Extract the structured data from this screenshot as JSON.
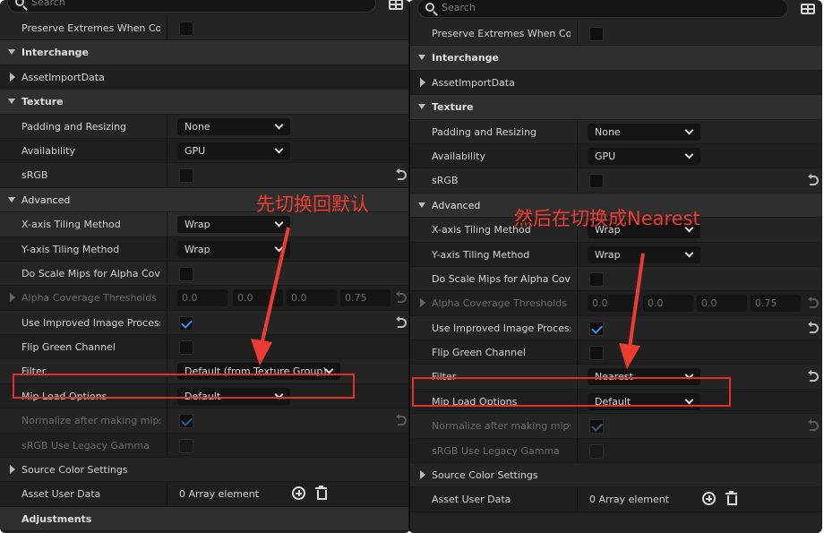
{
  "search": {
    "placeholder": "Search"
  },
  "left_panel": {
    "rows": {
      "preserve": "Preserve Extremes When Co...",
      "interchange": "Interchange",
      "asset_import": "AssetImportData",
      "texture": "Texture",
      "padding": "Padding and Resizing",
      "padding_val": "None",
      "availability": "Availability",
      "availability_val": "GPU",
      "srgb": "sRGB",
      "advanced": "Advanced",
      "xtiling": "X-axis Tiling Method",
      "xtiling_val": "Wrap",
      "ytiling": "Y-axis Tiling Method",
      "ytiling_val": "Wrap",
      "scale_mips": "Do Scale Mips for Alpha Cove...",
      "alpha_cov": "Alpha Coverage Thresholds",
      "alpha_vals": [
        "0.0",
        "0.0",
        "0.0",
        "0.75"
      ],
      "improved": "Use Improved Image Processi...",
      "flip_green": "Flip Green Channel",
      "filter": "Filter",
      "filter_val": "Default (from Texture Group)",
      "mip_load": "Mip Load Options",
      "mip_load_val": "Default",
      "normalize": "Normalize after making mips",
      "srgb_legacy": "sRGB Use Legacy Gamma",
      "source_color": "Source Color Settings",
      "asset_user": "Asset User Data",
      "array_element": "0 Array element",
      "adjustments": "Adjustments"
    },
    "annotation": "先切换回默认"
  },
  "right_panel": {
    "rows": {
      "filter_val": "Nearest"
    },
    "annotation": "然后在切换成Nearest"
  },
  "colors": {
    "accent": "#3a8ee6",
    "annotation_red": "#e5302a",
    "panel_bg": "#242424"
  }
}
